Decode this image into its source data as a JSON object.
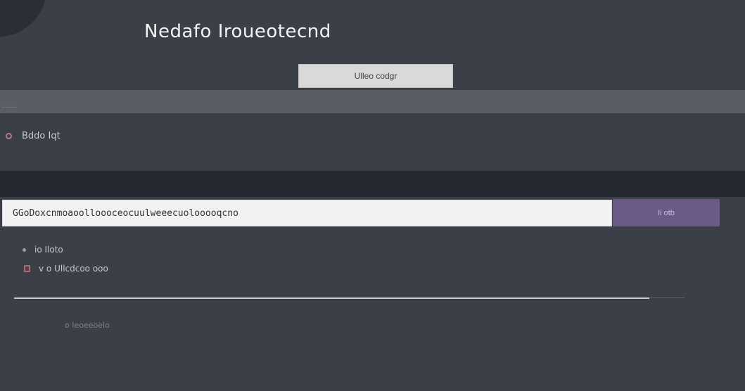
{
  "header": {
    "title": "Nedafo Iroueotecnd",
    "button_label": "Ulleo codgr"
  },
  "band": {
    "label": "........"
  },
  "row": {
    "label": "Bddo Iqt"
  },
  "command": {
    "value": "GGoDoxcnmoaoolloooceocuulweeecuolooooqcno",
    "send_label": "Ii otb"
  },
  "meta": {
    "line1": "io Iloto",
    "line2": "v o Ullcdcoo ooo"
  },
  "footer": {
    "text": "o Ieoeeoelo"
  },
  "colors": {
    "background": "#3b3f47",
    "band": "#585d66",
    "accent": "#6b5a86",
    "dark_band": "#25282e"
  },
  "icons": {
    "row": "circle-icon",
    "meta1": "dot-icon",
    "meta2": "square-icon"
  }
}
